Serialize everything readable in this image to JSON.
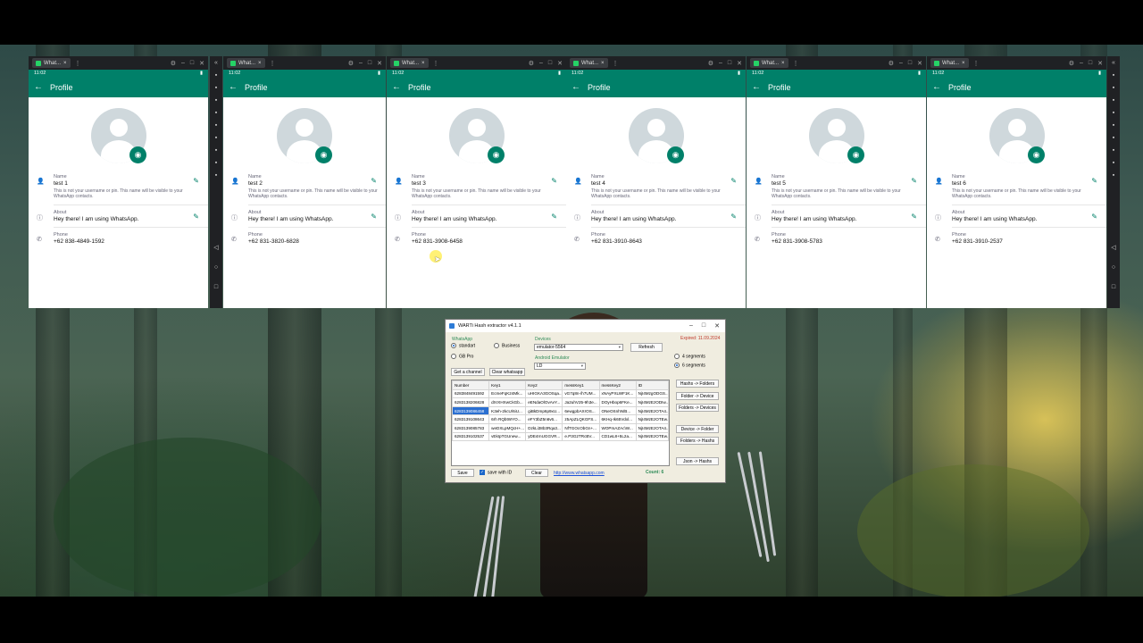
{
  "emulators": [
    {
      "tab_title": "What...",
      "time": "11:02",
      "header": "Profile",
      "name_label": "Name",
      "name": "test 1",
      "name_hint": "This is not your username or pin. This name will be visible to your WhatsApp contacts.",
      "about_label": "About",
      "about": "Hey there! I am using WhatsApp.",
      "phone_label": "Phone",
      "phone": "+62 838-4849-1592"
    },
    {
      "tab_title": "What...",
      "time": "11:02",
      "header": "Profile",
      "name_label": "Name",
      "name": "test 2",
      "name_hint": "This is not your username or pin. This name will be visible to your WhatsApp contacts.",
      "about_label": "About",
      "about": "Hey there! I am using WhatsApp.",
      "phone_label": "Phone",
      "phone": "+62 831-3820-6828"
    },
    {
      "tab_title": "What...",
      "time": "11:02",
      "header": "Profile",
      "name_label": "Name",
      "name": "test 3",
      "name_hint": "This is not your username or pin. This name will be visible to your WhatsApp contacts.",
      "about_label": "About",
      "about": "Hey there! I am using WhatsApp.",
      "phone_label": "Phone",
      "phone": "+62 831-3908-6458"
    },
    {
      "tab_title": "What...",
      "time": "11:02",
      "header": "Profile",
      "name_label": "Name",
      "name": "test 4",
      "name_hint": "This is not your username or pin. This name will be visible to your WhatsApp contacts.",
      "about_label": "About",
      "about": "Hey there! I am using WhatsApp.",
      "phone_label": "Phone",
      "phone": "+62 831-3910-8643"
    },
    {
      "tab_title": "What...",
      "time": "11:02",
      "header": "Profile",
      "name_label": "Name",
      "name": "test 5",
      "name_hint": "This is not your username or pin. This name will be visible to your WhatsApp contacts.",
      "about_label": "About",
      "about": "Hey there! I am using WhatsApp.",
      "phone_label": "Phone",
      "phone": "+62 831-3908-5783"
    },
    {
      "tab_title": "What...",
      "time": "11:02",
      "header": "Profile",
      "name_label": "Name",
      "name": "test 6",
      "name_hint": "This is not your username or pin. This name will be visible to your WhatsApp contacts.",
      "about_label": "About",
      "about": "Hey there! I am using WhatsApp.",
      "phone_label": "Phone",
      "phone": "+62 831-3910-2537"
    }
  ],
  "icons": {
    "back": "arrow-left-icon",
    "camera": "camera-icon",
    "person": "person-icon",
    "info": "info-icon",
    "phone": "phone-icon",
    "edit": "pencil-icon",
    "whatsapp": "whatsapp-icon"
  },
  "colors": {
    "whatsapp_green": "#008069",
    "camera_green": "#008069",
    "tool_bg": "#f0ede0",
    "expired_red": "#c0392b",
    "count_green": "#2e8b57",
    "link_blue": "#1a4fd8"
  },
  "tool": {
    "title": "WARTi Hash extractor v4.1.1",
    "group_whatsapp": "WhatsApp",
    "opt_standart": "standart",
    "opt_business": "Business",
    "opt_gb": "GB Pro",
    "devices_label": "Devices",
    "device_value": "emulator-5564",
    "refresh": "Refresh",
    "expired": "Expired: 11.09.2024",
    "emulator_label": "Android Emulator",
    "emulator_value": "LD",
    "seg4": "4 segments",
    "seg6": "6 segments",
    "get_channel": "Get a channel",
    "clear_whatsapp": "Clear whatsapp",
    "columns": [
      "Number",
      "Key1",
      "Key2",
      "messKey1",
      "messKey2",
      "ID"
    ],
    "rows": [
      [
        "6283848491592",
        "EcmeFqK24Mk...",
        "uHIGKA3GOSqa...",
        "vG7q8n-/h7UM...",
        "xNAyPXLWF1K...",
        "NjI4MzgODGS..."
      ],
      [
        "6283138206828",
        "dXrXHXwCkGb...",
        "eENdaOlOvAvY...",
        "Ja2uhV25-9h3e...",
        "DOyHbop6FKe...",
        "NjI4MzEzODIw..."
      ],
      [
        "6283139086458",
        "K3eh-2kcU/6iU...",
        "giBkDmp6p9xU...",
        "6ewgpbAXrOS...",
        "ONeOSnhN/B...",
        "NjI4MzEzOTA4..."
      ],
      [
        "6283139108643",
        "6rh RQbtWYO...",
        "eFY3bZ5n6v6...",
        "z5ApZLQKGFS...",
        "6KHq-Ik65Vdxl...",
        "NjI4MzEzOTEw..."
      ],
      [
        "6283139085783",
        "weDXLpMQcH+...",
        "DzkLi38b3Rqa3...",
        "NfTGOcObGn+...",
        "WOPmAZAc\\W...",
        "NjI4MzEzOTA4..."
      ],
      [
        "6283139102537",
        "vEkIpTGUnew...",
        "yDE4rnUGGVR...",
        "e.P3G2TRcBV...",
        "CD1wL8+5L2a...",
        "NjI4MzEzOTEw..."
      ]
    ],
    "btn_h2f": "Hashs -> Folders",
    "btn_f2d": "Folder -> Device",
    "btn_f2ds": "Folders -> Devices",
    "btn_d2f": "Device -> Folder",
    "btn_f2h": "Folders -> Hashs",
    "btn_j2h": "Json -> Hashs",
    "save": "Save",
    "save_with_id": "save with ID",
    "clear": "Clear",
    "link": "http://www.whatsapp.com",
    "count": "Count:  6"
  }
}
